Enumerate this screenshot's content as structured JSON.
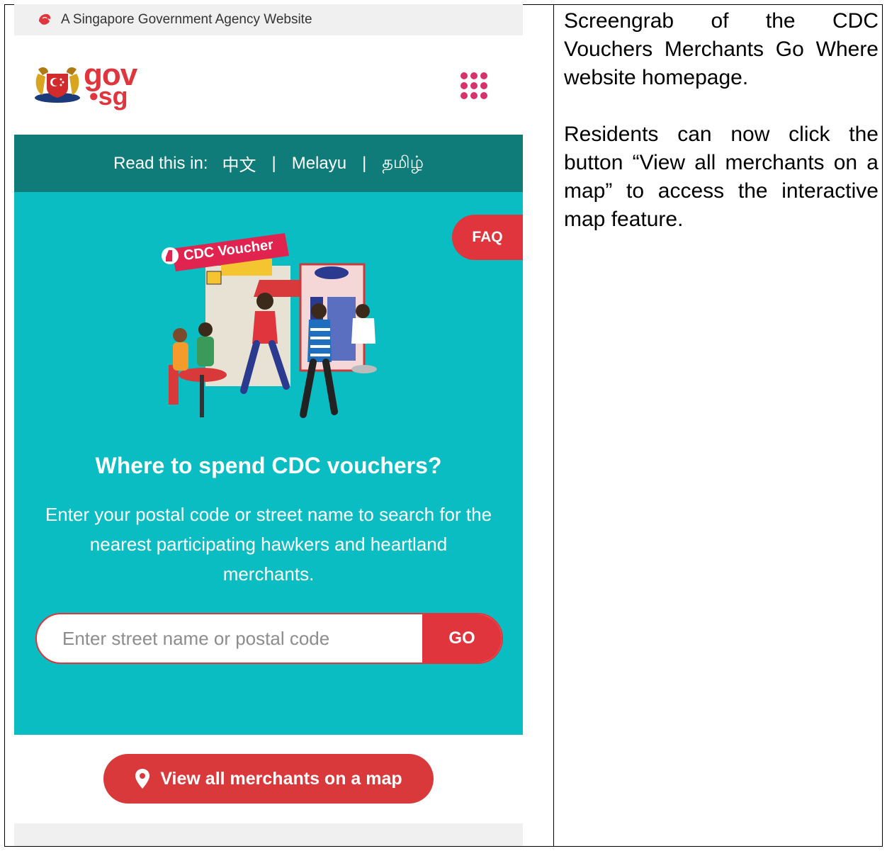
{
  "masthead": {
    "text": "A Singapore Government Agency Website"
  },
  "brand": {
    "logo_gov": "gov",
    "logo_sg": "•sg",
    "menu_icon": "grid-dots-icon"
  },
  "language_bar": {
    "label": "Read this in:",
    "options": [
      "中文",
      "Melayu",
      "தமிழ்"
    ],
    "separator": "|"
  },
  "hero": {
    "faq_label": "FAQ",
    "badge_text": "CDC Voucher",
    "heading": "Where to spend CDC vouchers?",
    "description": "Enter your postal code or street name to search for the nearest participating hawkers and heartland merchants."
  },
  "search": {
    "placeholder": "Enter street name or postal code",
    "value": "",
    "button_label": "GO"
  },
  "map_button": {
    "label": "View all merchants on a map",
    "icon": "map-pin-icon"
  },
  "caption": {
    "paragraph_1": "Screengrab of the CDC Vouchers Merchants Go Where website homepage.",
    "paragraph_2": "Residents can now click the button “View all merchants on a map” to access the interactive map feature."
  },
  "colors": {
    "teal_hero": "#09bdc3",
    "teal_dark": "#0f7c79",
    "red": "#e0353d",
    "gov_pink": "#d6336c"
  }
}
